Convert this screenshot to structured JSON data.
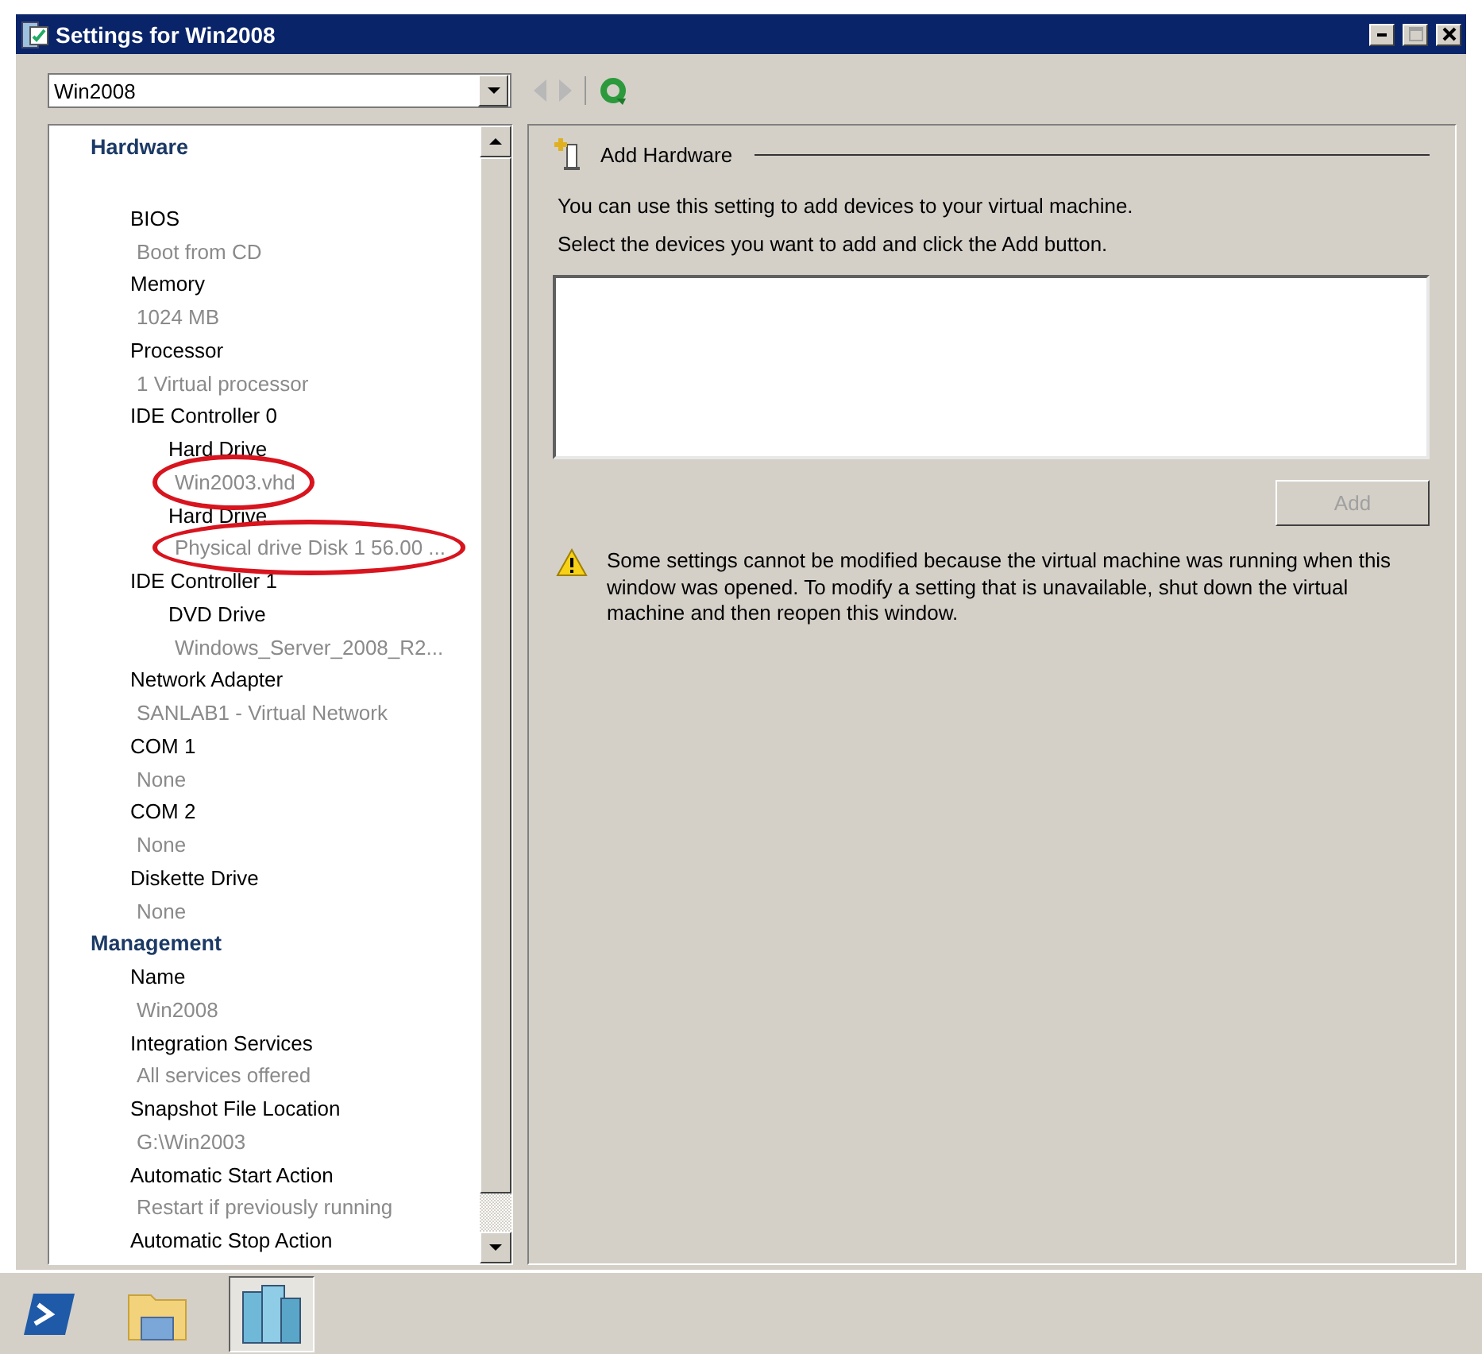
{
  "window": {
    "title": "Settings for Win2008",
    "buttons": [
      {
        "kind": "minimize",
        "disabled": false
      },
      {
        "kind": "maximize",
        "disabled": true
      },
      {
        "kind": "close",
        "disabled": false
      }
    ]
  },
  "vm_selector": {
    "value": "Win2008"
  },
  "toolbar": [
    {
      "kind": "back",
      "disabled": true
    },
    {
      "kind": "forward",
      "disabled": true
    },
    {
      "kind": "refresh",
      "disabled": false
    }
  ],
  "tree": {
    "sections": [
      {
        "title": "Hardware",
        "items": [
          {
            "label": "BIOS",
            "value": "Boot from CD",
            "circled": false
          },
          {
            "label": "Memory",
            "value": "1024 MB",
            "circled": false
          },
          {
            "label": "Processor",
            "value": "1 Virtual processor",
            "circled": false
          },
          {
            "label": "IDE Controller 0",
            "children": [
              {
                "label": "Hard Drive",
                "value": "Win2003.vhd",
                "circled": true
              },
              {
                "label": "Hard Drive",
                "value": "Physical drive Disk 1 56.00 ...",
                "circled": true
              }
            ]
          },
          {
            "label": "IDE Controller 1",
            "children": [
              {
                "label": "DVD Drive",
                "value": "Windows_Server_2008_R2...",
                "circled": false
              }
            ]
          },
          {
            "label": "Network Adapter",
            "value": "SANLAB1 - Virtual Network",
            "circled": false
          },
          {
            "label": "COM 1",
            "value": "None",
            "circled": false
          },
          {
            "label": "COM 2",
            "value": "None",
            "circled": false
          },
          {
            "label": "Diskette Drive",
            "value": "None",
            "circled": false
          }
        ]
      },
      {
        "title": "Management",
        "items": [
          {
            "label": "Name",
            "value": "Win2008",
            "circled": false
          },
          {
            "label": "Integration Services",
            "value": "All services offered",
            "circled": false
          },
          {
            "label": "Snapshot File Location",
            "value": "G:\\Win2003",
            "circled": false
          },
          {
            "label": "Automatic Start Action",
            "value": "Restart if previously running",
            "circled": false
          },
          {
            "label": "Automatic Stop Action"
          }
        ]
      }
    ]
  },
  "pane": {
    "title": "Add Hardware",
    "description": [
      "You can use this setting to add devices to your virtual machine.",
      "Select the devices you want to add and click the Add button."
    ],
    "add_button": {
      "label": "Add",
      "disabled": true
    },
    "warning": "Some settings cannot be modified because the virtual machine was running when this window was opened. To modify a setting that is unavailable, shut down the virtual machine and then reopen this window."
  },
  "taskbar": [
    {
      "kind": "powershell",
      "selected": false
    },
    {
      "kind": "explorer",
      "selected": false
    },
    {
      "kind": "server",
      "selected": true
    }
  ]
}
